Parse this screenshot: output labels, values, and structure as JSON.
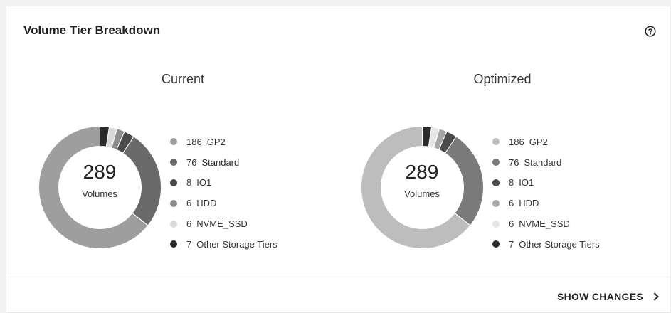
{
  "card": {
    "title": "Volume Tier Breakdown",
    "help_icon": "question-circle-icon",
    "show_changes_label": "SHOW CHANGES",
    "chevron_icon": "chevron-right-icon"
  },
  "chart_data": [
    {
      "type": "pie",
      "variant": "donut",
      "title": "Current",
      "center_value": "289",
      "center_label": "Volumes",
      "categories": [
        "GP2",
        "Standard",
        "IO1",
        "HDD",
        "NVME_SSD",
        "Other Storage Tiers"
      ],
      "values": [
        186,
        76,
        8,
        6,
        6,
        7
      ],
      "colors": [
        "#9e9e9e",
        "#6a6a6a",
        "#4a4a4a",
        "#8c8c8c",
        "#d9d9d9",
        "#2b2b2b"
      ]
    },
    {
      "type": "pie",
      "variant": "donut",
      "title": "Optimized",
      "center_value": "289",
      "center_label": "Volumes",
      "categories": [
        "GP2",
        "Standard",
        "IO1",
        "HDD",
        "NVME_SSD",
        "Other Storage Tiers"
      ],
      "values": [
        186,
        76,
        8,
        6,
        6,
        7
      ],
      "colors": [
        "#bdbdbd",
        "#7a7a7a",
        "#4a4a4a",
        "#a6a6a6",
        "#e6e6e6",
        "#2b2b2b"
      ]
    }
  ]
}
